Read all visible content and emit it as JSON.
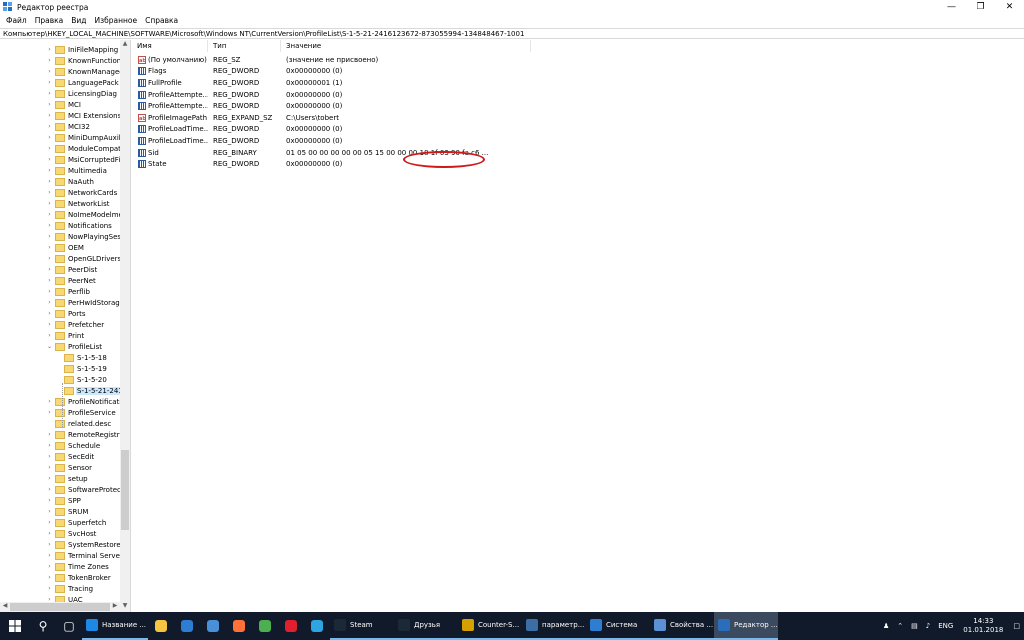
{
  "window": {
    "title": "Редактор реестра"
  },
  "menu": [
    "Файл",
    "Правка",
    "Вид",
    "Избранное",
    "Справка"
  ],
  "address": "Компьютер\\HKEY_LOCAL_MACHINE\\SOFTWARE\\Microsoft\\Windows NT\\CurrentVersion\\ProfileList\\S-1-5-21-2416123672-873055994-134848467-1001",
  "tree": {
    "items": [
      {
        "label": "IniFileMapping",
        "level": 1,
        "expandable": true
      },
      {
        "label": "KnownFunctionT",
        "level": 1,
        "expandable": true
      },
      {
        "label": "KnownManaged",
        "level": 1,
        "expandable": true
      },
      {
        "label": "LanguagePack",
        "level": 1,
        "expandable": true
      },
      {
        "label": "LicensingDiag",
        "level": 1,
        "expandable": true
      },
      {
        "label": "MCI",
        "level": 1,
        "expandable": true
      },
      {
        "label": "MCI Extensions",
        "level": 1,
        "expandable": true
      },
      {
        "label": "MCI32",
        "level": 1,
        "expandable": true
      },
      {
        "label": "MiniDumpAuxili",
        "level": 1,
        "expandable": true
      },
      {
        "label": "ModuleCompati",
        "level": 1,
        "expandable": true
      },
      {
        "label": "MsiCorruptedFil",
        "level": 1,
        "expandable": true
      },
      {
        "label": "Multimedia",
        "level": 1,
        "expandable": true
      },
      {
        "label": "NaAuth",
        "level": 1,
        "expandable": true
      },
      {
        "label": "NetworkCards",
        "level": 1,
        "expandable": true
      },
      {
        "label": "NetworkList",
        "level": 1,
        "expandable": true
      },
      {
        "label": "NoImeModelme",
        "level": 1,
        "expandable": true
      },
      {
        "label": "Notifications",
        "level": 1,
        "expandable": true
      },
      {
        "label": "NowPlayingSess",
        "level": 1,
        "expandable": true
      },
      {
        "label": "OEM",
        "level": 1,
        "expandable": true
      },
      {
        "label": "OpenGLDrivers",
        "level": 1,
        "expandable": true
      },
      {
        "label": "PeerDist",
        "level": 1,
        "expandable": true
      },
      {
        "label": "PeerNet",
        "level": 1,
        "expandable": true
      },
      {
        "label": "Perflib",
        "level": 1,
        "expandable": true
      },
      {
        "label": "PerHwIdStorage",
        "level": 1,
        "expandable": true
      },
      {
        "label": "Ports",
        "level": 1,
        "expandable": true
      },
      {
        "label": "Prefetcher",
        "level": 1,
        "expandable": true
      },
      {
        "label": "Print",
        "level": 1,
        "expandable": true
      },
      {
        "label": "ProfileList",
        "level": 1,
        "expandable": true,
        "expanded": true
      },
      {
        "label": "S-1-5-18",
        "level": 2,
        "expandable": false
      },
      {
        "label": "S-1-5-19",
        "level": 2,
        "expandable": false
      },
      {
        "label": "S-1-5-20",
        "level": 2,
        "expandable": false
      },
      {
        "label": "S-1-5-21-241(",
        "level": 2,
        "expandable": false,
        "selected": true
      },
      {
        "label": "ProfileNotificati",
        "level": 1,
        "expandable": true
      },
      {
        "label": "ProfileService",
        "level": 1,
        "expandable": true
      },
      {
        "label": "related.desc",
        "level": 1,
        "expandable": false
      },
      {
        "label": "RemoteRegistry",
        "level": 1,
        "expandable": true
      },
      {
        "label": "Schedule",
        "level": 1,
        "expandable": true
      },
      {
        "label": "SecEdit",
        "level": 1,
        "expandable": true
      },
      {
        "label": "Sensor",
        "level": 1,
        "expandable": true
      },
      {
        "label": "setup",
        "level": 1,
        "expandable": true
      },
      {
        "label": "SoftwareProtecti",
        "level": 1,
        "expandable": true
      },
      {
        "label": "SPP",
        "level": 1,
        "expandable": true
      },
      {
        "label": "SRUM",
        "level": 1,
        "expandable": true
      },
      {
        "label": "Superfetch",
        "level": 1,
        "expandable": true
      },
      {
        "label": "SvcHost",
        "level": 1,
        "expandable": true
      },
      {
        "label": "SystemRestore",
        "level": 1,
        "expandable": true
      },
      {
        "label": "Terminal Server",
        "level": 1,
        "expandable": true
      },
      {
        "label": "Time Zones",
        "level": 1,
        "expandable": true
      },
      {
        "label": "TokenBroker",
        "level": 1,
        "expandable": true
      },
      {
        "label": "Tracing",
        "level": 1,
        "expandable": true
      },
      {
        "label": "UAC",
        "level": 1,
        "expandable": true
      }
    ]
  },
  "columns": {
    "name": "Имя",
    "type": "Тип",
    "value": "Значение"
  },
  "values": [
    {
      "name": "(По умолчанию)",
      "type": "REG_SZ",
      "value": "(значение не присвоено)",
      "icon": "string"
    },
    {
      "name": "Flags",
      "type": "REG_DWORD",
      "value": "0x00000000 (0)",
      "icon": "binary"
    },
    {
      "name": "FullProfile",
      "type": "REG_DWORD",
      "value": "0x00000001 (1)",
      "icon": "binary"
    },
    {
      "name": "ProfileAttempte...",
      "type": "REG_DWORD",
      "value": "0x00000000 (0)",
      "icon": "binary"
    },
    {
      "name": "ProfileAttempte...",
      "type": "REG_DWORD",
      "value": "0x00000000 (0)",
      "icon": "binary"
    },
    {
      "name": "ProfileImagePath",
      "type": "REG_EXPAND_SZ",
      "value": "C:\\Users\\tobert",
      "icon": "string"
    },
    {
      "name": "ProfileLoadTime...",
      "type": "REG_DWORD",
      "value": "0x00000000 (0)",
      "icon": "binary"
    },
    {
      "name": "ProfileLoadTime...",
      "type": "REG_DWORD",
      "value": "0x00000000 (0)",
      "icon": "binary"
    },
    {
      "name": "Sid",
      "type": "REG_BINARY",
      "value": "01 05 00 00 00 00 00 05 15 00 00 00 18 1f 03 90 fa c6 ...",
      "icon": "binary"
    },
    {
      "name": "State",
      "type": "REG_DWORD",
      "value": "0x00000000 (0)",
      "icon": "binary"
    }
  ],
  "taskbar": {
    "apps": [
      {
        "label": "Название ...",
        "color": "#1e88e5"
      },
      {
        "label": "Steam",
        "color": "#1b2838"
      },
      {
        "label": "Друзья",
        "color": "#1b2838"
      },
      {
        "label": "Counter-S...",
        "color": "#d6a000"
      },
      {
        "label": "параметр...",
        "color": "#3a6ea5"
      },
      {
        "label": "Система",
        "color": "#2d7dd2"
      },
      {
        "label": "Свойства ...",
        "color": "#5b8fd6"
      },
      {
        "label": "Редактор ...",
        "color": "#2a6ebb",
        "active": true
      }
    ],
    "lang": "ENG",
    "time": "14:33",
    "date": "01.01.2018"
  }
}
